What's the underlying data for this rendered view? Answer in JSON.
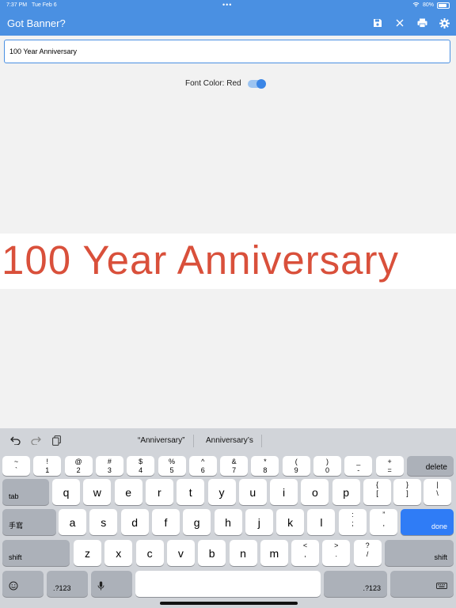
{
  "status": {
    "time": "7:37 PM",
    "date": "Tue Feb 6",
    "dots": "•••",
    "battery": "80%"
  },
  "nav": {
    "title": "Got Banner?"
  },
  "input": {
    "value": "100 Year Anniversary"
  },
  "font_color": {
    "label": "Font Color: Red",
    "enabled": true
  },
  "banner": {
    "text": "100 Year Anniversary",
    "color": "#d9503b"
  },
  "suggestions": [
    "“Anniversary”",
    "Anniversary’s"
  ],
  "keyboard": {
    "row1": [
      [
        "~",
        "`"
      ],
      [
        "!",
        "1"
      ],
      [
        "@",
        "2"
      ],
      [
        "#",
        "3"
      ],
      [
        "$",
        "4"
      ],
      [
        "%",
        "5"
      ],
      [
        "^",
        "6"
      ],
      [
        "&",
        "7"
      ],
      [
        "*",
        "8"
      ],
      [
        "(",
        "9"
      ],
      [
        ")",
        "0"
      ],
      [
        "_",
        "-"
      ],
      [
        "+",
        "="
      ]
    ],
    "delete": "delete",
    "tab": "tab",
    "row2": [
      "q",
      "w",
      "e",
      "r",
      "t",
      "y",
      "u",
      "i",
      "o",
      "p"
    ],
    "row2p": [
      [
        "{",
        "["
      ],
      [
        "}",
        "]"
      ],
      [
        "|",
        "\\"
      ]
    ],
    "handwrite": "手寫",
    "row3": [
      "a",
      "s",
      "d",
      "f",
      "g",
      "h",
      "j",
      "k",
      "l"
    ],
    "row3p": [
      [
        ":",
        ";"
      ],
      [
        "”",
        ","
      ]
    ],
    "done": "done",
    "shift": "shift",
    "row4": [
      "z",
      "x",
      "c",
      "v",
      "b",
      "n",
      "m"
    ],
    "row4p": [
      [
        "<",
        ","
      ],
      [
        ">",
        "."
      ],
      [
        "?",
        "/"
      ]
    ],
    "num": ".?123"
  },
  "colors": {
    "accent": "#4a90e2",
    "banner_text": "#d9503b",
    "done_key": "#2f7cf6"
  }
}
